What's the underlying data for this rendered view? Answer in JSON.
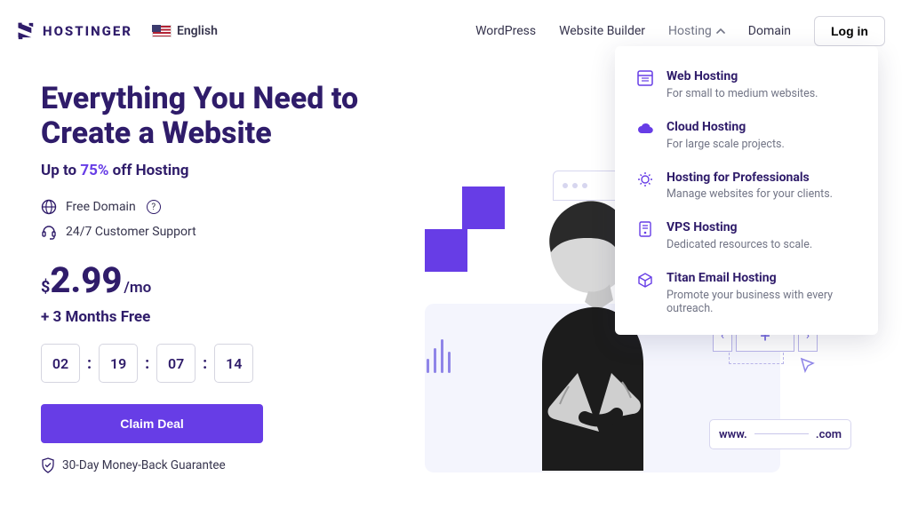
{
  "header": {
    "brand": "HOSTINGER",
    "language": "English",
    "nav": {
      "wordpress": "WordPress",
      "builder": "Website Builder",
      "hosting": "Hosting",
      "domain": "Domain"
    },
    "login": "Log in"
  },
  "dropdown": [
    {
      "title": "Web Hosting",
      "sub": "For small to medium websites."
    },
    {
      "title": "Cloud Hosting",
      "sub": "For large scale projects."
    },
    {
      "title": "Hosting for Professionals",
      "sub": "Manage websites for your clients."
    },
    {
      "title": "VPS Hosting",
      "sub": "Dedicated resources to scale."
    },
    {
      "title": "Titan Email Hosting",
      "sub": "Promote your business with every outreach."
    }
  ],
  "hero": {
    "headline": "Everything You Need to Create a Website",
    "sub_pre": "Up to ",
    "sub_pct": "75%",
    "sub_post": " off Hosting",
    "feat_domain": "Free Domain",
    "feat_support": "24/7 Customer Support",
    "currency": "$",
    "price": "2.99",
    "per": "/mo",
    "months_free": "+ 3 Months Free",
    "timer": {
      "d": "02",
      "h": "19",
      "m": "07",
      "s": "14"
    },
    "cta": "Claim Deal",
    "guarantee": "30-Day Money-Back Guarantee"
  },
  "stage": {
    "www": "www.",
    "com": ".com"
  }
}
